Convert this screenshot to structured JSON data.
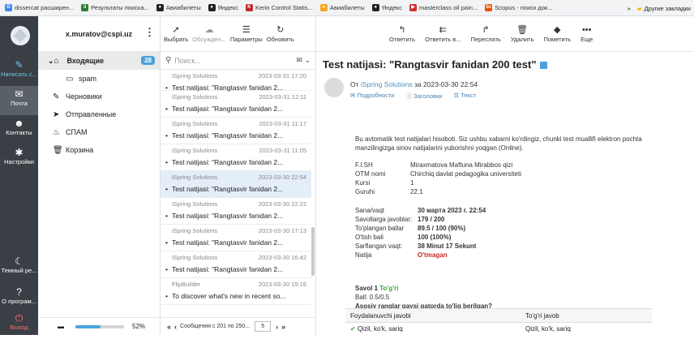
{
  "bookmarks": [
    {
      "label": "dissercat расширен...",
      "color": "#4285f4",
      "icon": "G"
    },
    {
      "label": "Результаты поиска...",
      "color": "#2e7d32",
      "icon": "il"
    },
    {
      "label": "Авиабилеты",
      "color": "#222222",
      "icon": "●"
    },
    {
      "label": "Яндекс",
      "color": "#222222",
      "icon": "●"
    },
    {
      "label": "Kerio Control Statis...",
      "color": "#c62828",
      "icon": "K"
    },
    {
      "label": "Авиабилеты",
      "color": "#f5a623",
      "icon": "●"
    },
    {
      "label": "Яндекс",
      "color": "#222222",
      "icon": "●"
    },
    {
      "label": "masterclass oil pain...",
      "color": "#d32f2f",
      "icon": "▶"
    },
    {
      "label": "Scopus - поиск док...",
      "color": "#e65100",
      "icon": "Sc"
    }
  ],
  "bookmarks_more": "»",
  "bookmarks_other": "Другие закладки",
  "nav": {
    "compose": "Написать с...",
    "mail": "Почта",
    "contacts": "Контакты",
    "settings": "Настройки",
    "theme": "Темный ре...",
    "about": "О програм...",
    "exit": "Выход"
  },
  "account": "x.muratov@cspi.uz",
  "folders": [
    {
      "label": "Входящие",
      "icon": "inbox-icon",
      "glyph": "⌂",
      "badge": "28"
    },
    {
      "label": "spam",
      "icon": "folder-icon",
      "glyph": "▭"
    },
    {
      "label": "Черновики",
      "icon": "pencil-icon",
      "glyph": "✎"
    },
    {
      "label": "Отправленные",
      "icon": "send-icon",
      "glyph": "➤"
    },
    {
      "label": "СПАМ",
      "icon": "flame-icon",
      "glyph": "♨"
    },
    {
      "label": "Корзина",
      "icon": "trash-icon",
      "glyph": "🗑"
    }
  ],
  "quota": {
    "percent": "52%",
    "fraction": 0.52
  },
  "list_toolbar": {
    "select": "Выбрать",
    "discuss": "Обсужден...",
    "params": "Параметры",
    "refresh": "Обновить"
  },
  "search": {
    "placeholder": "Поиск..."
  },
  "messages": [
    {
      "sender": "iSpring Solutions",
      "date": "2023-03-31 17:20",
      "subject": "Test natijasi: \"Rangtasvir fanidan 2..."
    },
    {
      "sender": "iSpring Solutions",
      "date": "2023-03-31 12:11",
      "subject": "Test natijasi: \"Rangtasvir fanidan 2..."
    },
    {
      "sender": "iSpring Solutions",
      "date": "2023-03-31 11:17",
      "subject": "Test natijasi: \"Rangtasvir fanidan 2..."
    },
    {
      "sender": "iSpring Solutions",
      "date": "2023-03-31 11:05",
      "subject": "Test natijasi: \"Rangtasvir fanidan 2..."
    },
    {
      "sender": "iSpring Solutions",
      "date": "2023-03-30 22:54",
      "subject": "Test natijasi: \"Rangtasvir fanidan 2..."
    },
    {
      "sender": "iSpring Solutions",
      "date": "2023-03-30 22:22",
      "subject": "Test natijasi: \"Rangtasvir fanidan 2..."
    },
    {
      "sender": "iSpring Solutions",
      "date": "2023-03-30 17:13",
      "subject": "Test natijasi: \"Rangtasvir fanidan 2..."
    },
    {
      "sender": "iSpring Solutions",
      "date": "2023-03-30 16:42",
      "subject": "Test natijasi: \"Rangtasvir fanidan 2..."
    },
    {
      "sender": "FlipBuilder",
      "date": "2023-03-30 15:16",
      "subject": "To discover what's new in recent so..."
    }
  ],
  "pager": {
    "text": "Сообщения с 201 по 250...",
    "page": "5"
  },
  "reader_toolbar": {
    "reply": "Ответить",
    "reply_all": "Ответить в...",
    "forward": "Переслать",
    "delete": "Удалить",
    "mark": "Пометить",
    "more": "Еще"
  },
  "message": {
    "subject": "Test natijasi: \"Rangtasvir fanidan 200 test\"",
    "from_prefix": "От",
    "from": "iSpring Solutions",
    "date": "за 2023-03-30 22:54",
    "details": "Подробности",
    "headers": "Заголовки",
    "text": "Текст",
    "intro": "Bu avtomatik test natijalari hisoboti. Siz ushbu xabarni ko'rdingiz, chunki test muallifi elektron pochta manzilingizga sinov natijalarini yuborishni yoqgan (Online).",
    "info": [
      {
        "k": "F.I.SH",
        "v": "Miraxmatova Maftuna Mirabbos qizi"
      },
      {
        "k": "OTM nomi",
        "v": "Chirchiq davlat pedagogika universiteti"
      },
      {
        "k": "Kursi",
        "v": "1"
      },
      {
        "k": "Guruhi",
        "v": "22.1"
      }
    ],
    "stats": [
      {
        "k": "Sana/vaqt",
        "v": "30 марта 2023 г. 22:54"
      },
      {
        "k": "Savollarga javoblar:",
        "v": "179 / 200"
      },
      {
        "k": "To'plangan ballar",
        "v": "89.5 / 100 (90%)"
      },
      {
        "k": "O'tish bali",
        "v": "100 (100%)"
      },
      {
        "k": "Sarflangan vaqt:",
        "v": "38 Minut 17 Sekunt"
      }
    ],
    "natija_k": "Natija",
    "natija_v": "O'tmagan",
    "q_title": "Savol 1",
    "q_status": "To'g'ri",
    "q_ball": "Ball: 0.5/0.5",
    "q_text": "Asosiy ranglar qaysi qatorda to'liq berilgan?",
    "col1": "Foydalanuvchi javobi",
    "col2": "To'g'ri javob",
    "ans_user": "Qizil, ko'k, sariq",
    "ans_correct": "Qizil, ko'k, sariq"
  }
}
